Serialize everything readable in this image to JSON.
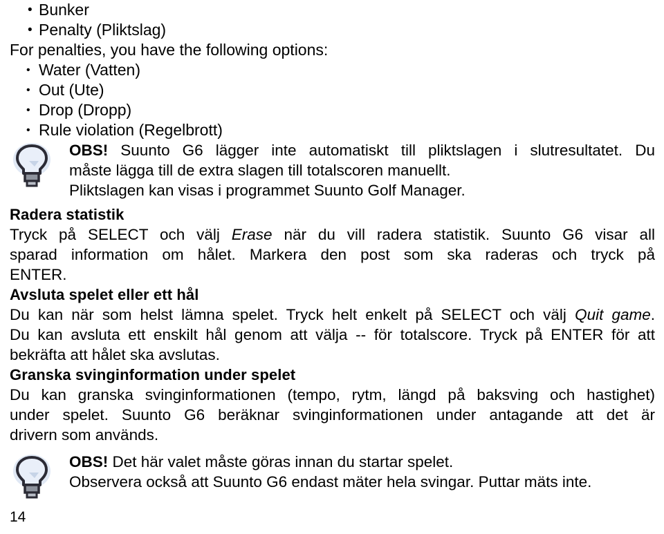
{
  "document": {
    "page_number": "14",
    "language": "sv-SE"
  },
  "lists": {
    "first": [
      {
        "label": "Bunker"
      },
      {
        "label": "Penalty (Pliktslag)"
      }
    ],
    "intro_line": "For penalties, you have the following options:",
    "second": [
      {
        "label": "Water (Vatten)"
      },
      {
        "label": "Out (Ute)"
      },
      {
        "label": "Drop (Dropp)"
      },
      {
        "label": "Rule violation (Regelbrott)"
      }
    ]
  },
  "note_top": {
    "icon": "lightbulb-icon",
    "bold_lead": "OBS!",
    "line1_rest": " Suunto G6 lägger inte automatiskt till pliktslagen i slutresultatet. Du",
    "line2": "måste lägga till de extra slagen till totalscoren manuellt.",
    "line3": "Pliktslagen kan visas i programmet Suunto Golf Manager."
  },
  "sections": [
    {
      "id": "radera-statistik",
      "heading": "Radera statistik",
      "lines": [
        {
          "pre": "Tryck på SELECT och välj ",
          "em": "Erase",
          "post": " när du vill radera statistik. Suunto G6 visar all",
          "justified": true
        },
        {
          "pre": "sparad information om hålet. Markera den post som ska raderas och tryck på",
          "em": "",
          "post": "",
          "justified": true
        },
        {
          "pre": "ENTER.",
          "em": "",
          "post": "",
          "justified": false
        }
      ]
    },
    {
      "id": "avsluta-spelet",
      "heading": "Avsluta spelet eller ett hål",
      "lines": [
        {
          "pre": "Du kan när som helst lämna spelet. Tryck helt enkelt på SELECT och välj ",
          "em": "Quit game",
          "post": ".",
          "justified": true
        },
        {
          "pre": "Du kan avsluta ett enskilt hål genom att välja -- för totalscore. Tryck på ENTER för att",
          "em": "",
          "post": "",
          "justified": true
        },
        {
          "pre": "bekräfta att hålet ska avslutas.",
          "em": "",
          "post": "",
          "justified": false
        }
      ]
    },
    {
      "id": "granska-svinginformation",
      "heading": "Granska svinginformation under spelet",
      "lines": [
        {
          "pre": "Du kan granska svinginformationen (tempo, rytm, längd på baksving och hastighet)",
          "em": "",
          "post": "",
          "justified": true
        },
        {
          "pre": "under spelet. Suunto G6 beräknar svinginformationen under antagande att det är",
          "em": "",
          "post": "",
          "justified": true
        },
        {
          "pre": "drivern som används.",
          "em": "",
          "post": "",
          "justified": false
        }
      ]
    }
  ],
  "note_bottom": {
    "icon": "lightbulb-icon",
    "bold_lead": "OBS!",
    "line1_rest": " Det här valet måste göras innan du startar spelet.",
    "line2": "Observera också att Suunto G6 endast mäter hela svingar. Puttar mäts inte."
  },
  "colors": {
    "text": "#000000",
    "background": "#ffffff",
    "bulb_outline": "#2b2b35",
    "bulb_glow": "#c6d2e6",
    "bulb_fill": "#e8eef7",
    "bulb_base": "#6a6f7a"
  }
}
